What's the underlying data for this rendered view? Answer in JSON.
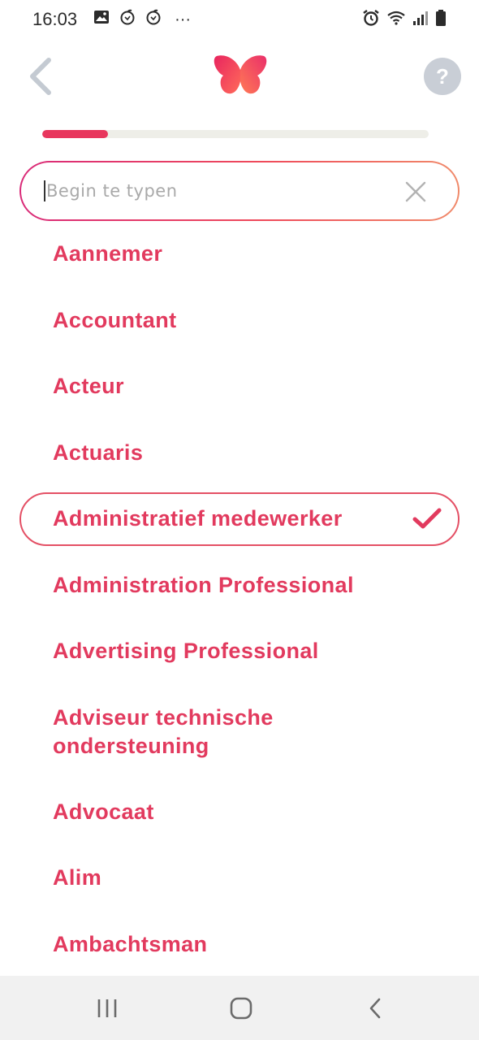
{
  "status_bar": {
    "time": "16:03",
    "more": "···",
    "icons": [
      "gallery-icon",
      "app-notification-icon",
      "app-notification-icon",
      "alarm-icon",
      "wifi-icon",
      "signal-icon",
      "battery-icon"
    ]
  },
  "header": {
    "back_icon": "chevron-left-icon",
    "logo_icon": "butterfly-logo-icon",
    "help_label": "?"
  },
  "progress": {
    "fraction": 0.17
  },
  "search": {
    "placeholder": "Begin te typen",
    "value": "",
    "clear_icon": "close-icon"
  },
  "list": {
    "items": [
      {
        "label": "Aannemer",
        "selected": false
      },
      {
        "label": "Accountant",
        "selected": false
      },
      {
        "label": "Acteur",
        "selected": false
      },
      {
        "label": "Actuaris",
        "selected": false
      },
      {
        "label": "Administratief medewerker",
        "selected": true
      },
      {
        "label": "Administration Professional",
        "selected": false
      },
      {
        "label": "Advertising Professional",
        "selected": false
      },
      {
        "label": "Adviseur technische ondersteuning",
        "selected": false
      },
      {
        "label": "Advocaat",
        "selected": false
      },
      {
        "label": "Alim",
        "selected": false
      },
      {
        "label": "Ambachtsman",
        "selected": false
      }
    ]
  },
  "colors": {
    "accent": "#e23a5e",
    "progress_track": "#eeeee8",
    "help_bg": "#c9ced6",
    "nav_bg": "#f1f1f1"
  },
  "nav_bar": {
    "icons": [
      "recent-apps-icon",
      "home-icon",
      "back-icon"
    ]
  }
}
